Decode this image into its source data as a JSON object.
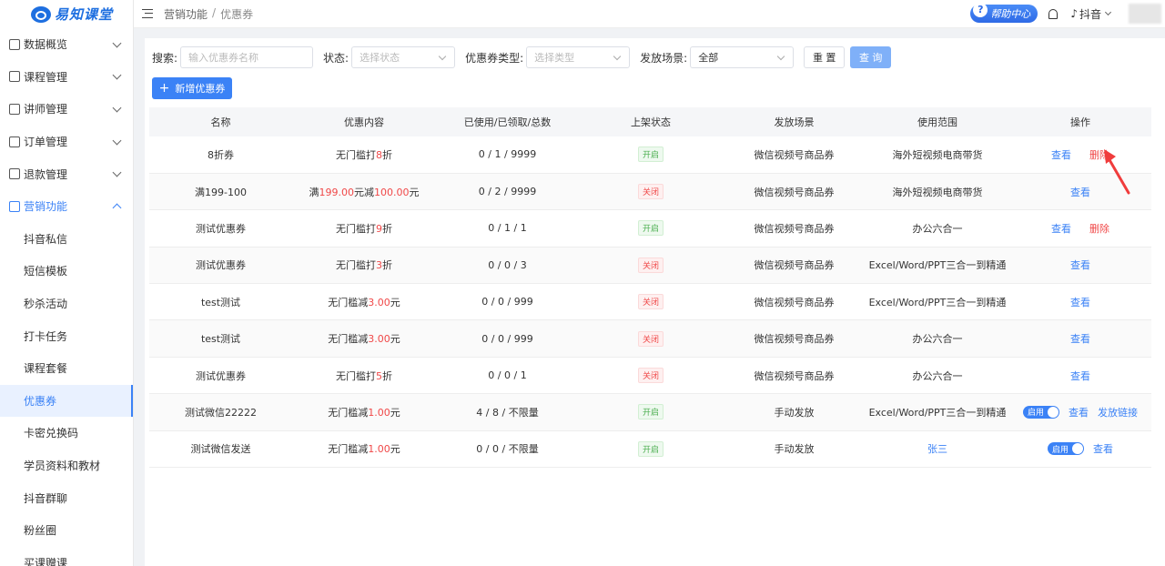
{
  "app": {
    "logo_text": "易知课堂"
  },
  "header": {
    "breadcrumb": [
      "营销功能",
      "优惠券"
    ],
    "help_label": "帮助中心",
    "douyin_label": "抖音"
  },
  "sidebar": {
    "items": [
      {
        "label": "数据概览"
      },
      {
        "label": "课程管理"
      },
      {
        "label": "讲师管理"
      },
      {
        "label": "订单管理"
      },
      {
        "label": "退款管理"
      },
      {
        "label": "营销功能"
      }
    ],
    "subitems": [
      {
        "label": "抖音私信"
      },
      {
        "label": "短信模板"
      },
      {
        "label": "秒杀活动"
      },
      {
        "label": "打卡任务"
      },
      {
        "label": "课程套餐"
      },
      {
        "label": "优惠券"
      },
      {
        "label": "卡密兑换码"
      },
      {
        "label": "学员资料和教材"
      },
      {
        "label": "抖音群聊"
      },
      {
        "label": "粉丝圈"
      },
      {
        "label": "买课赠课"
      }
    ]
  },
  "filters": {
    "search_label": "搜索:",
    "search_placeholder": "输入优惠券名称",
    "status_label": "状态:",
    "status_placeholder": "选择状态",
    "type_label": "优惠券类型:",
    "type_placeholder": "选择类型",
    "scene_label": "发放场景:",
    "scene_value": "全部",
    "reset_label": "重 置",
    "query_label": "查 询",
    "add_label": "新增优惠券"
  },
  "table": {
    "headers": [
      "名称",
      "优惠内容",
      "已使用/已领取/总数",
      "上架状态",
      "发放场景",
      "使用范围",
      "操作"
    ],
    "rows": [
      {
        "name": "8折券",
        "c1": "无门槛打",
        "c2": "8",
        "c3": "折",
        "c4": "",
        "c5": "",
        "counts": "0 / 1 / 9999",
        "status": "开启",
        "scene": "微信视频号商品券",
        "scope": "海外短视频电商带货",
        "ops": [
          "查看",
          "删除"
        ]
      },
      {
        "name": "满199-100",
        "c1": "满",
        "c2": "199.00",
        "c3": "元减",
        "c4": "100.00",
        "c5": "元",
        "counts": "0 / 2 / 9999",
        "status": "关闭",
        "scene": "微信视频号商品券",
        "scope": "海外短视频电商带货",
        "ops": [
          "查看"
        ]
      },
      {
        "name": "测试优惠券",
        "c1": "无门槛打",
        "c2": "9",
        "c3": "折",
        "c4": "",
        "c5": "",
        "counts": "0 / 1 / 1",
        "status": "开启",
        "scene": "微信视频号商品券",
        "scope": "办公六合一",
        "ops": [
          "查看",
          "删除"
        ]
      },
      {
        "name": "测试优惠券",
        "c1": "无门槛打",
        "c2": "3",
        "c3": "折",
        "c4": "",
        "c5": "",
        "counts": "0 / 0 / 3",
        "status": "关闭",
        "scene": "微信视频号商品券",
        "scope": "Excel/Word/PPT三合一到精通",
        "ops": [
          "查看"
        ]
      },
      {
        "name": "test测试",
        "c1": "无门槛减",
        "c2": "3.00",
        "c3": "元",
        "c4": "",
        "c5": "",
        "counts": "0 / 0 / 999",
        "status": "关闭",
        "scene": "微信视频号商品券",
        "scope": "Excel/Word/PPT三合一到精通",
        "ops": [
          "查看"
        ]
      },
      {
        "name": "test测试",
        "c1": "无门槛减",
        "c2": "3.00",
        "c3": "元",
        "c4": "",
        "c5": "",
        "counts": "0 / 0 / 999",
        "status": "关闭",
        "scene": "微信视频号商品券",
        "scope": "办公六合一",
        "ops": [
          "查看"
        ]
      },
      {
        "name": "测试优惠券",
        "c1": "无门槛打",
        "c2": "5",
        "c3": "折",
        "c4": "",
        "c5": "",
        "counts": "0 / 0 / 1",
        "status": "关闭",
        "scene": "微信视频号商品券",
        "scope": "办公六合一",
        "ops": [
          "查看"
        ]
      },
      {
        "name": "测试微信22222",
        "c1": "无门槛减",
        "c2": "1.00",
        "c3": "元",
        "c4": "",
        "c5": "",
        "counts": "4 / 8 / 不限量",
        "status": "开启",
        "scene": "手动发放",
        "scope": "Excel/Word/PPT三合一到精通",
        "toggle": "启用",
        "ops": [
          "查看",
          "发放链接"
        ]
      },
      {
        "name": "测试微信发送",
        "c1": "无门槛减",
        "c2": "1.00",
        "c3": "元",
        "c4": "",
        "c5": "",
        "counts": "0 / 0 / 不限量",
        "status": "开启",
        "scene": "手动发放",
        "scope": "张三",
        "scope_link": true,
        "toggle": "启用",
        "ops": [
          "查看"
        ]
      }
    ]
  },
  "colors": {
    "accent": "#3b82f6",
    "danger": "#f04848",
    "success": "#4caf50"
  }
}
